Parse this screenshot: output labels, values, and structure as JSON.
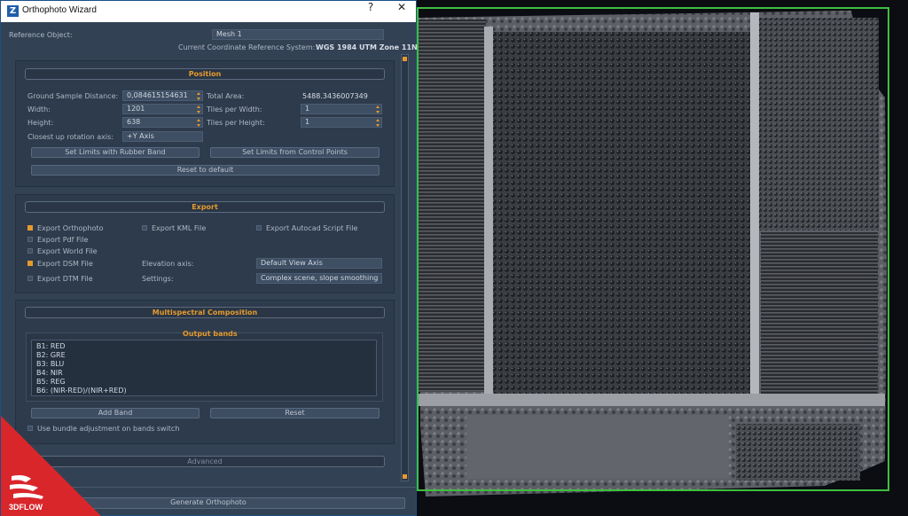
{
  "window": {
    "title": "Orthophoto Wizard",
    "help_label": "?",
    "minimize_label": "—",
    "close_label": "✕",
    "app_icon": "Z"
  },
  "reference": {
    "object_label": "Reference Object:",
    "object_value": "Mesh 1",
    "crs_label": "Current Coordinate Reference System:",
    "crs_value": "WGS 1984 UTM Zone 11N"
  },
  "position": {
    "header": "Position",
    "gsd_label": "Ground Sample Distance:",
    "gsd_value": "0,084615154631",
    "total_area_label": "Total Area:",
    "total_area_value": "5488.3436007349",
    "width_label": "Width:",
    "width_value": "1201",
    "tiles_w_label": "Tiles per Width:",
    "tiles_w_value": "1",
    "height_label": "Height:",
    "height_value": "638",
    "tiles_h_label": "Tiles per Height:",
    "tiles_h_value": "1",
    "rotation_label": "Closest up rotation axis:",
    "rotation_value": "+Y Axis",
    "btn_rubber_band": "Set Limits with Rubber Band",
    "btn_control_points": "Set Limits from Control Points",
    "btn_reset": "Reset to default"
  },
  "export": {
    "header": "Export",
    "orthophoto": "Export Orthophoto",
    "kml": "Export KML File",
    "autocad": "Export Autocad Script File",
    "pdf": "Export Pdf File",
    "world": "Export World File",
    "dsm": "Export DSM File",
    "dtm": "Export DTM File",
    "elevation_label": "Elevation axis:",
    "elevation_value": "Default View Axis",
    "settings_label": "Settings:",
    "settings_value": "Complex scene, slope smoothing"
  },
  "multispectral": {
    "header": "Multispectral Composition",
    "output_bands_label": "Output bands",
    "bands": [
      "B1: RED",
      "B2: GRE",
      "B3: BLU",
      "B4: NIR",
      "B5: REG",
      "B6: (NIR-RED)/(NIR+RED)"
    ],
    "btn_add_band": "Add Band",
    "btn_reset": "Reset",
    "bundle_adjust": "Use bundle adjustment on bands switch"
  },
  "advanced_label": "Advanced",
  "generate_label": "Generate Orthophoto",
  "logo_text": "3DFLOW",
  "colors": {
    "accent": "#e59a2d",
    "panel": "#334155",
    "logo_red": "#d9262b",
    "bbox_green": "#3fbf3f"
  }
}
